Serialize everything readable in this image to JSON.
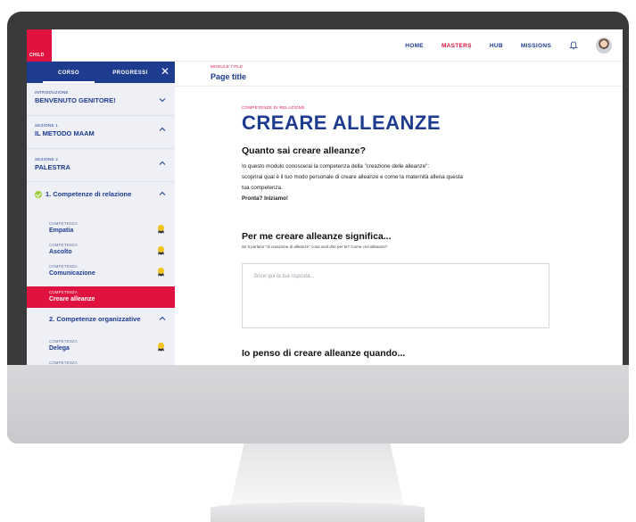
{
  "topnav": {
    "logo_text": "CHILD",
    "links": [
      "HOME",
      "MASTERS",
      "HUB",
      "MISSIONS"
    ],
    "active_link": "MASTERS"
  },
  "sidebar": {
    "tabs": [
      "CORSO",
      "PROGRESSI"
    ],
    "sections": [
      {
        "small": "INTRODUZIONE",
        "title": "BENVENUTO GENITORE!",
        "chevron": "down"
      },
      {
        "small": "SEZIONE 1",
        "title": "IL METODO MAAM",
        "chevron": "up"
      },
      {
        "small": "SEZIONE 2",
        "title": "PALESTRA",
        "chevron": "up"
      }
    ],
    "competence_groups": [
      {
        "title": "1. Competenze di relazione",
        "completed": true
      },
      {
        "title": "2. Competenze organizzative",
        "completed": false
      }
    ],
    "items": [
      {
        "small": "COMPETENZA",
        "title": "Empatia",
        "badge": true
      },
      {
        "small": "COMPETENZA",
        "title": "Ascolto",
        "badge": true
      },
      {
        "small": "COMPETENZA",
        "title": "Comunicazione",
        "badge": true
      },
      {
        "small": "COMPETENZA",
        "title": "Creare alleanze",
        "badge": false,
        "active": true
      },
      {
        "small": "COMPETENZA",
        "title": "Delega",
        "badge": true
      },
      {
        "small": "COMPETENZA",
        "title": "",
        "badge": false
      }
    ]
  },
  "page_header": {
    "small": "MODULE TITLE",
    "title": "Page title"
  },
  "content": {
    "kicker": "COMPETENZE DI RELAZIONE",
    "title": "CREARE ALLEANZE",
    "subtitle": "Quanto sai creare alleanze?",
    "para1": "In questo modulo conoscerai la competenza della \"creazione delle alleanze\":",
    "para2": "scoprirai qual è il tuo modo personale di creare alleanze e come la maternità allena questa",
    "para3": "tua competenza.",
    "para4": "Pronta? Iniziamo!",
    "q1_title": "Per me creare alleanze significa...",
    "q1_sub": "Se ti parlano \"di creazione di alleanze\" cosa vuol dire per te? Come crei alleanze?",
    "answer_placeholder": "Scrivi qui la tua risposta...",
    "q2_title": "Io penso di creare alleanze quando..."
  },
  "colors": {
    "brand_blue": "#1d3b8f",
    "brand_red": "#e0123f",
    "check_green": "#9ccf3a",
    "badge_yellow": "#f4c21c"
  }
}
